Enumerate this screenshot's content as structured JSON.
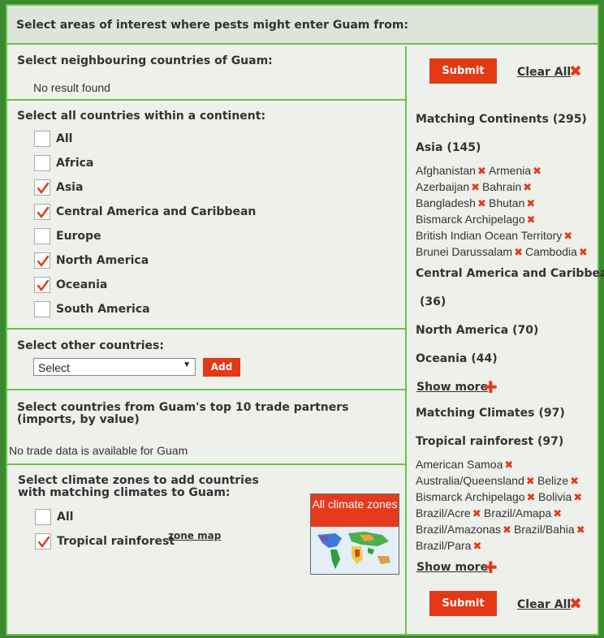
{
  "header": {
    "title": "Select areas of interest where pests might enter Guam from:"
  },
  "neighbours": {
    "title": "Select neighbouring countries of Guam:",
    "empty": "No result found"
  },
  "continents": {
    "title": "Select all countries within a continent:",
    "items": [
      {
        "label": "All",
        "checked": false
      },
      {
        "label": "Africa",
        "checked": false
      },
      {
        "label": "Asia",
        "checked": true
      },
      {
        "label": "Central America and Caribbean",
        "checked": true
      },
      {
        "label": "Europe",
        "checked": false
      },
      {
        "label": "North America",
        "checked": true
      },
      {
        "label": "Oceania",
        "checked": true
      },
      {
        "label": "South America",
        "checked": false
      }
    ]
  },
  "other": {
    "title": "Select other countries:",
    "select_value": "Select",
    "add_label": "Add"
  },
  "trade": {
    "title": "Select countries from Guam's top 10 trade partners (imports, by value)",
    "empty": "No trade data is available for Guam"
  },
  "climate": {
    "title": "Select climate zones to add countries with matching climates to Guam:",
    "items": [
      {
        "label": "All",
        "checked": false
      },
      {
        "label": "Tropical rainforest",
        "checked": true
      }
    ],
    "zone_map": "zone map",
    "image_text": "All climate zones"
  },
  "actions": {
    "submit": "Submit",
    "clear_all": "Clear All"
  },
  "matches": {
    "continents_label": "Matching Continents",
    "continents_count": "(295)",
    "asia": {
      "label": "Asia",
      "count": "(145)",
      "countries": [
        "Afghanistan",
        "Armenia",
        "Azerbaijan",
        "Bahrain",
        "Bangladesh",
        "Bhutan",
        "Bismarck Archipelago",
        "British Indian Ocean Territory",
        "Brunei Darussalam",
        "Cambodia"
      ]
    },
    "cac": {
      "label": "Central America and Caribbean",
      "count": "(36)"
    },
    "na": {
      "label": "North America",
      "count": "(70)"
    },
    "oceania": {
      "label": "Oceania",
      "count": "(44)"
    },
    "show_more": "Show more",
    "climates_label": "Matching Climates",
    "climates_count": "(97)",
    "tropical": {
      "label": "Tropical rainforest",
      "count": "(97)",
      "countries": [
        "American Samoa",
        "Australia/Queensland",
        "Belize",
        "Bismarck Archipelago",
        "Bolivia",
        "Brazil/Acre",
        "Brazil/Amapa",
        "Brazil/Amazonas",
        "Brazil/Bahia",
        "Brazil/Para"
      ]
    }
  },
  "colors": {
    "accent": "#e33914",
    "border": "#6cc24a",
    "header_bg": "#dde4d9"
  },
  "icons": {
    "remove": "close-icon",
    "add": "plus-icon",
    "check": "checkmark-icon"
  }
}
